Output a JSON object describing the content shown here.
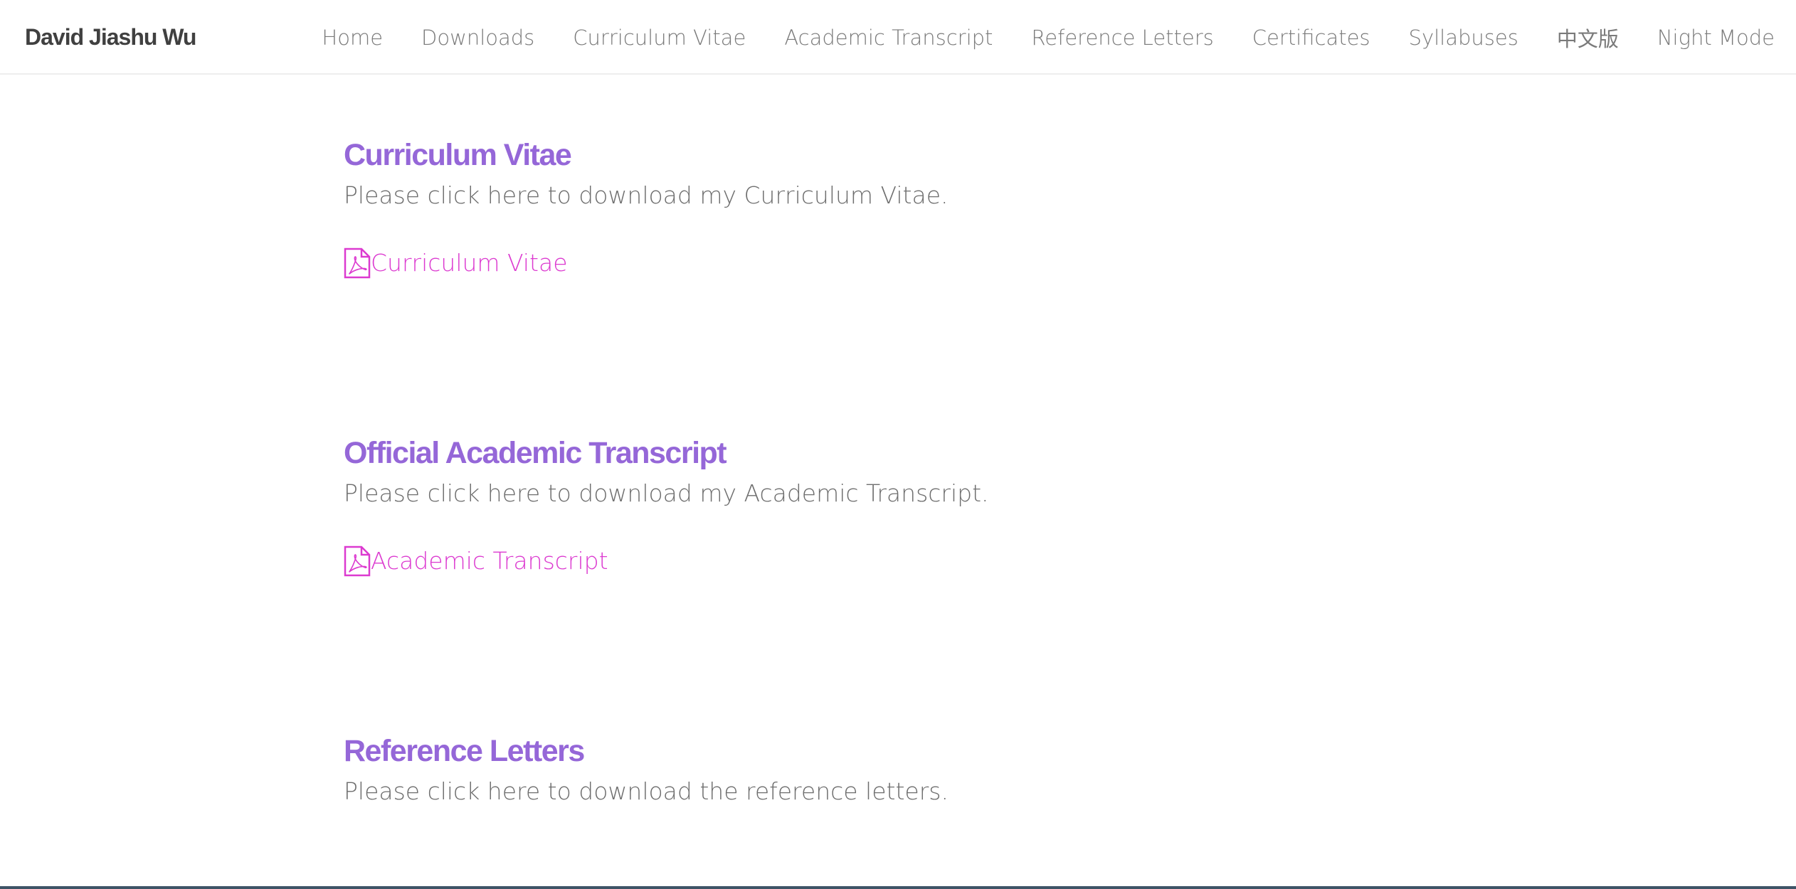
{
  "nav": {
    "brand": "David Jiashu Wu",
    "links": [
      {
        "label": "Home"
      },
      {
        "label": "Downloads"
      },
      {
        "label": "Curriculum Vitae"
      },
      {
        "label": "Academic Transcript"
      },
      {
        "label": "Reference Letters"
      },
      {
        "label": "Certificates"
      },
      {
        "label": "Syllabuses"
      },
      {
        "label": "中文版"
      },
      {
        "label": "Night Mode"
      }
    ]
  },
  "sections": [
    {
      "title": "Curriculum Vitae",
      "description": "Please click here to download my Curriculum Vitae.",
      "link": {
        "label": "Curriculum Vitae",
        "icon": "file-pdf-icon"
      }
    },
    {
      "title": "Official Academic Transcript",
      "description": "Please click here to download my Academic Transcript.",
      "link": {
        "label": "Academic Transcript",
        "icon": "file-pdf-icon"
      }
    },
    {
      "title": "Reference Letters",
      "description": "Please click here to download the reference letters."
    }
  ],
  "colors": {
    "heading": "#9567d8",
    "link": "#dc3ad0",
    "text": "#6e6e6e",
    "nav_text": "#7a7a7a",
    "brand": "#404040",
    "footer_bar": "#3e5466"
  }
}
